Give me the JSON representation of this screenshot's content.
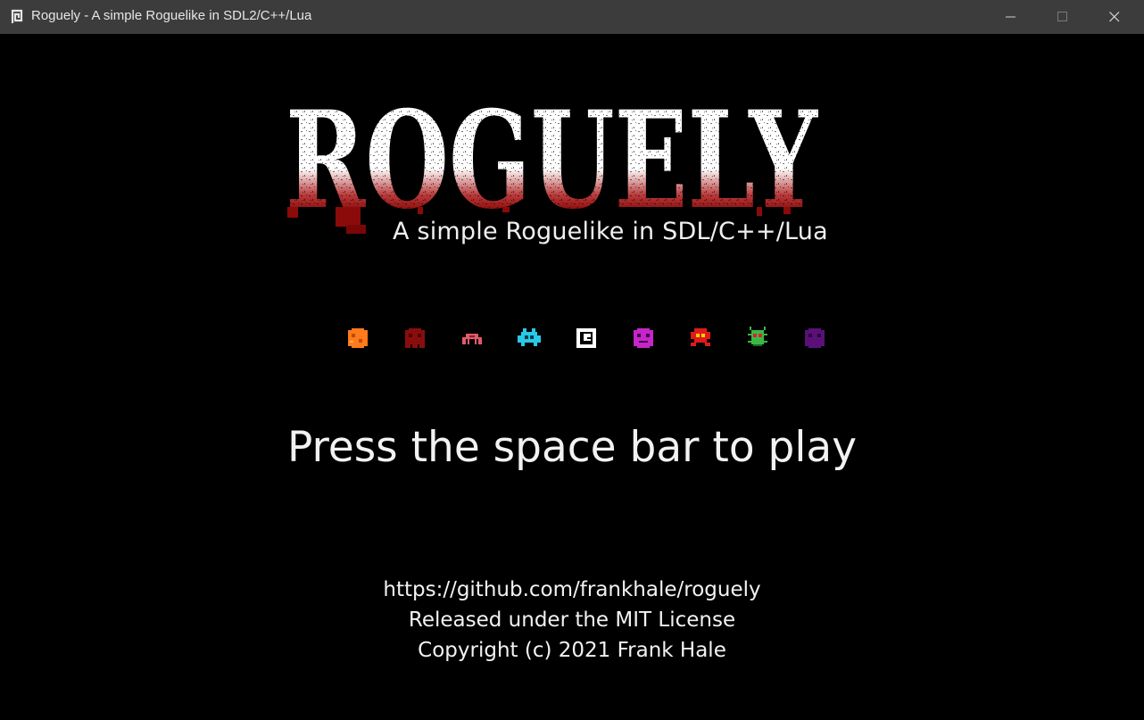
{
  "window": {
    "title": "Roguely - A simple Roguelike in SDL2/C++/Lua",
    "app_icon": "spiral-icon",
    "controls": [
      "minimize-icon",
      "maximize-icon",
      "close-icon"
    ]
  },
  "logo": {
    "text": "ROGUELY",
    "colors": {
      "top": "#ffffff",
      "bottom": "#8b0a0a"
    }
  },
  "subtitle": "A simple Roguelike in SDL/C++/Lua",
  "sprites": [
    {
      "name": "orange-blob-sprite",
      "color": "#ff7a1a"
    },
    {
      "name": "dark-red-blob-sprite",
      "color": "#8a0d0d"
    },
    {
      "name": "pink-crab-sprite",
      "color": "#e05a6a"
    },
    {
      "name": "cyan-invader-sprite",
      "color": "#29c8e6"
    },
    {
      "name": "white-spiral-player-sprite",
      "color": "#ffffff"
    },
    {
      "name": "magenta-face-sprite",
      "color": "#c426c8"
    },
    {
      "name": "red-invader-sprite",
      "color": "#e01a1a"
    },
    {
      "name": "green-bug-sprite",
      "color": "#39b845"
    },
    {
      "name": "purple-blob-sprite",
      "color": "#5a1078"
    }
  ],
  "prompt": "Press the space bar to play",
  "credits": {
    "url": "https://github.com/frankhale/roguely",
    "license": "Released under the MIT License",
    "copyright": "Copyright (c) 2021 Frank Hale"
  }
}
